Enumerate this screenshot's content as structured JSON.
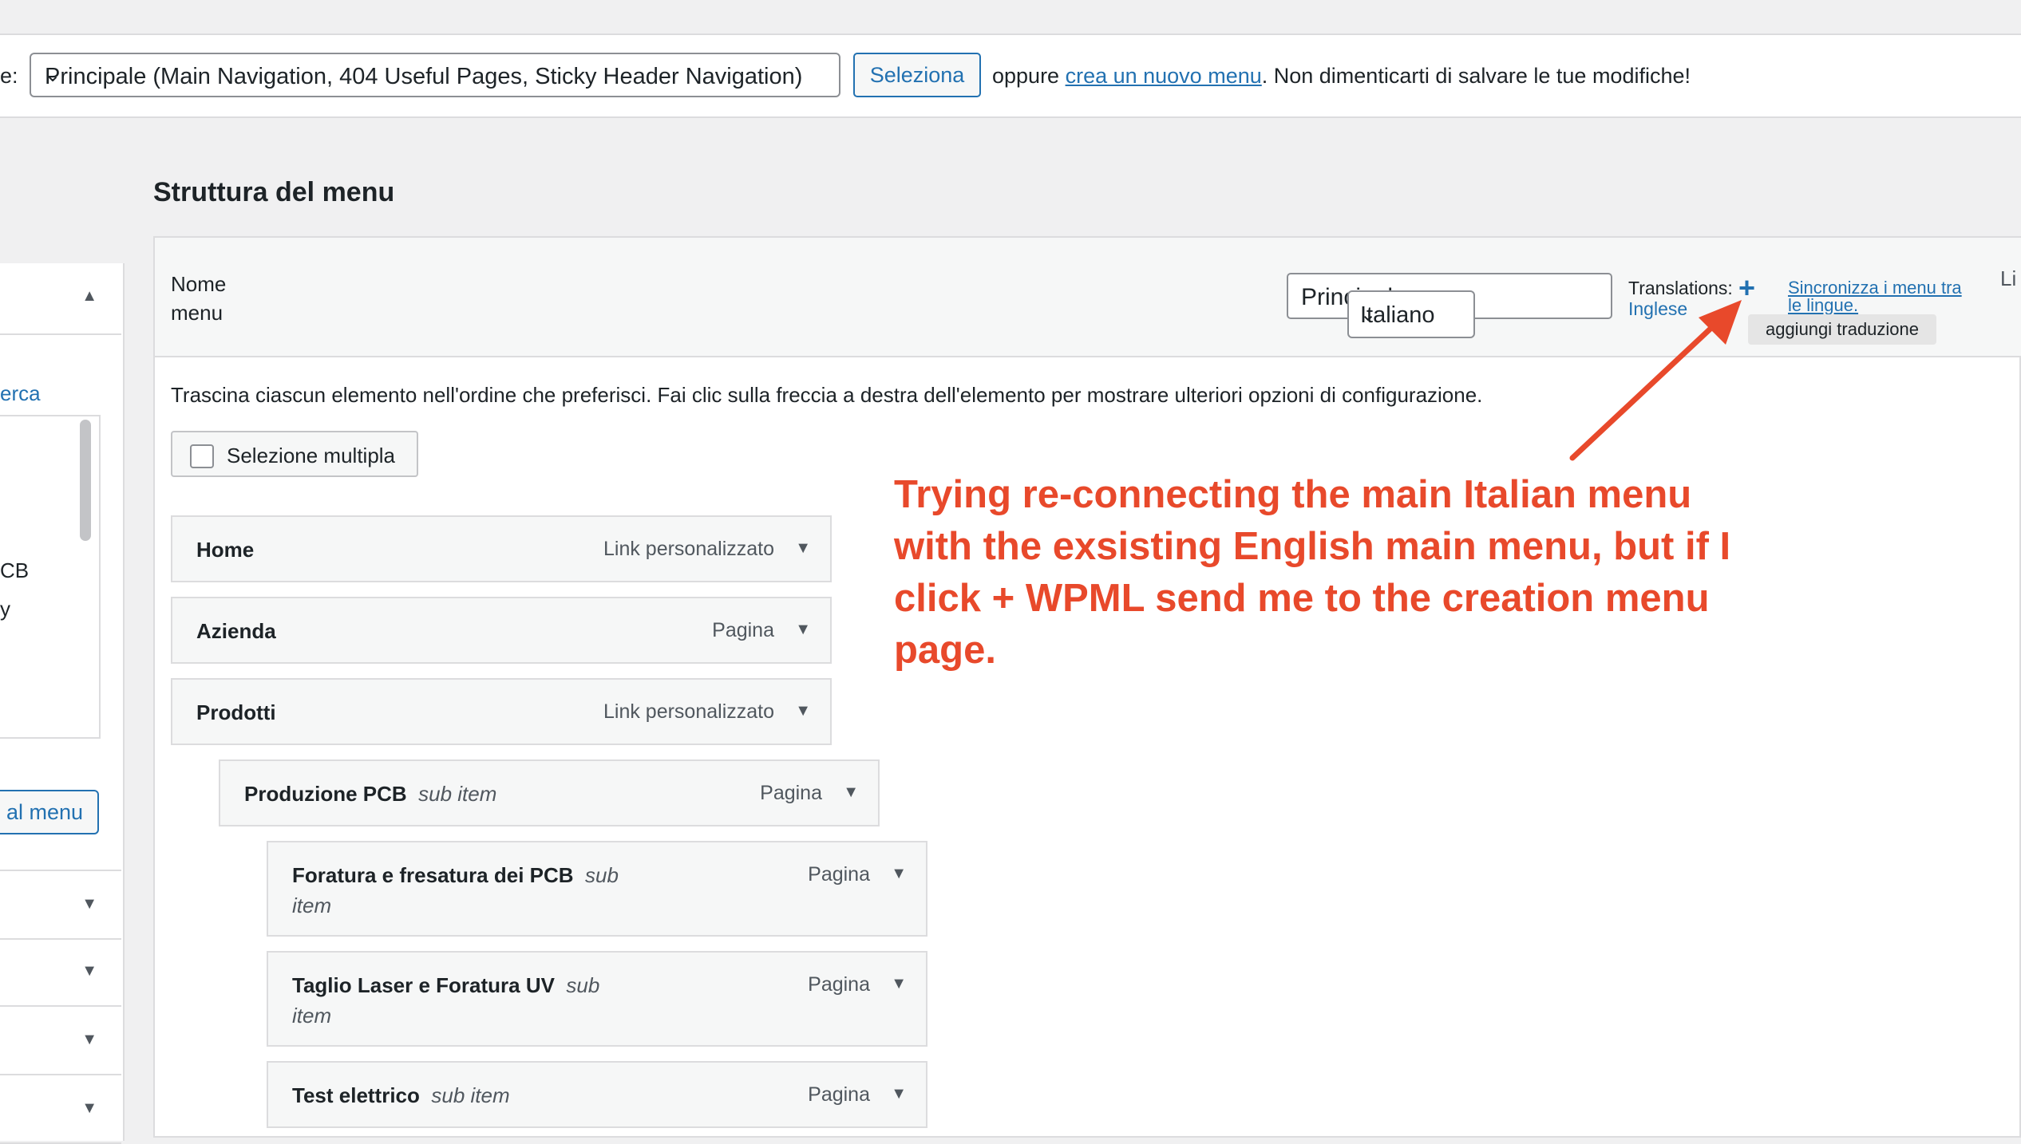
{
  "topbar": {
    "label_fragment": "e:",
    "menu_select_value": "Principale (Main Navigation, 404 Useful Pages, Sticky Header Navigation)",
    "select_button": "Seleziona",
    "oppure_text": "oppure ",
    "create_link": "crea un nuovo menu",
    "save_reminder": ". Non dimenticarti di salvare le tue modifiche!"
  },
  "left_panel": {
    "search_fragment": "erca",
    "list_fragment_1": "CB",
    "list_fragment_2": "y",
    "add_button_fragment": "al menu"
  },
  "heading": "Struttura del menu",
  "name_bar": {
    "label": "Nome menu",
    "name_value": "Principale",
    "language_value": "Italiano",
    "translations_label": "Translations:",
    "translation_language": "Inglese",
    "sync_link": "Sincronizza i menu tra le lingue.",
    "tooltip": "aggiungi traduzione",
    "cut_label": "Li"
  },
  "instructions": "Trascina ciascun elemento nell'ordine che preferisci. Fai clic sulla freccia a destra dell'elemento per mostrare ulteriori opzioni di configurazione.",
  "multi_select_label": "Selezione multipla",
  "sub_item_label": "sub item",
  "menu_items": [
    {
      "title": "Home",
      "type": "Link personalizzato",
      "sub": false
    },
    {
      "title": "Azienda",
      "type": "Pagina",
      "sub": false
    },
    {
      "title": "Prodotti",
      "type": "Link personalizzato",
      "sub": false
    },
    {
      "title": "Produzione PCB",
      "type": "Pagina",
      "sub": true
    },
    {
      "title": "Foratura e fresatura dei PCB",
      "type": "Pagina",
      "sub": true
    },
    {
      "title": "Taglio Laser e Foratura UV",
      "type": "Pagina",
      "sub": true
    },
    {
      "title": "Test elettrico",
      "type": "Pagina",
      "sub": true
    }
  ],
  "annotation": "Trying re-connecting the  main Italian menu with the exsisting English main menu, but if I click + WPML send me to the creation menu page.",
  "colors": {
    "accent": "#2271b1",
    "annotation": "#e8492b"
  }
}
